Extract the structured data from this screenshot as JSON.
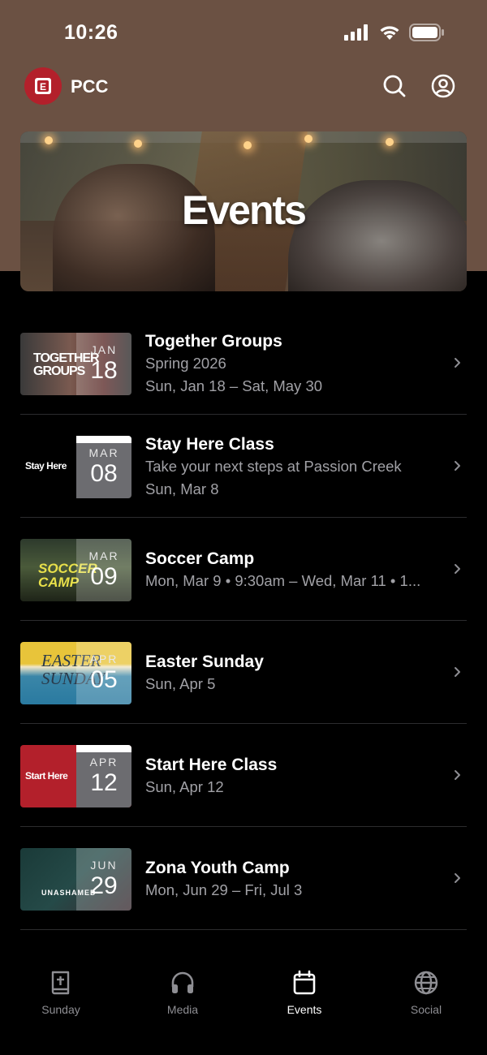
{
  "status": {
    "time": "10:26"
  },
  "header": {
    "brand": "PCC",
    "logo_letter": "E"
  },
  "hero": {
    "title": "Events"
  },
  "events": [
    {
      "title": "Together Groups",
      "lines": [
        "Spring 2026",
        "Sun, Jan 18 – Sat, May 30"
      ],
      "month": "JAN",
      "day": "18",
      "thumb_text": "TOGETHER GROUPS"
    },
    {
      "title": "Stay Here Class",
      "lines": [
        "Take your next steps at Passion Creek",
        "Sun, Mar 8"
      ],
      "month": "MAR",
      "day": "08",
      "thumb_text": "Stay Here"
    },
    {
      "title": "Soccer Camp",
      "lines": [
        "Mon, Mar 9 • 9:30am – Wed, Mar 11 • 1..."
      ],
      "month": "MAR",
      "day": "09",
      "thumb_text": "SOCCER CAMP"
    },
    {
      "title": "Easter Sunday",
      "lines": [
        "Sun, Apr 5"
      ],
      "month": "APR",
      "day": "05",
      "thumb_text": "EASTER SUNDAY"
    },
    {
      "title": "Start Here Class",
      "lines": [
        "Sun, Apr 12"
      ],
      "month": "APR",
      "day": "12",
      "thumb_text": "Start Here"
    },
    {
      "title": "Zona Youth Camp",
      "lines": [
        "Mon, Jun 29 – Fri, Jul 3"
      ],
      "month": "JUN",
      "day": "29",
      "thumb_text": "UNASHAMED"
    }
  ],
  "tabs": [
    {
      "label": "Sunday",
      "icon": "bible-icon",
      "active": false
    },
    {
      "label": "Media",
      "icon": "headphones-icon",
      "active": false
    },
    {
      "label": "Events",
      "icon": "calendar-icon",
      "active": true
    },
    {
      "label": "Social",
      "icon": "globe-icon",
      "active": false
    }
  ],
  "colors": {
    "header_bg": "#6b5143",
    "brand_red": "#b3202b",
    "page_bg": "#000000",
    "secondary_text": "#a1a1a6"
  }
}
